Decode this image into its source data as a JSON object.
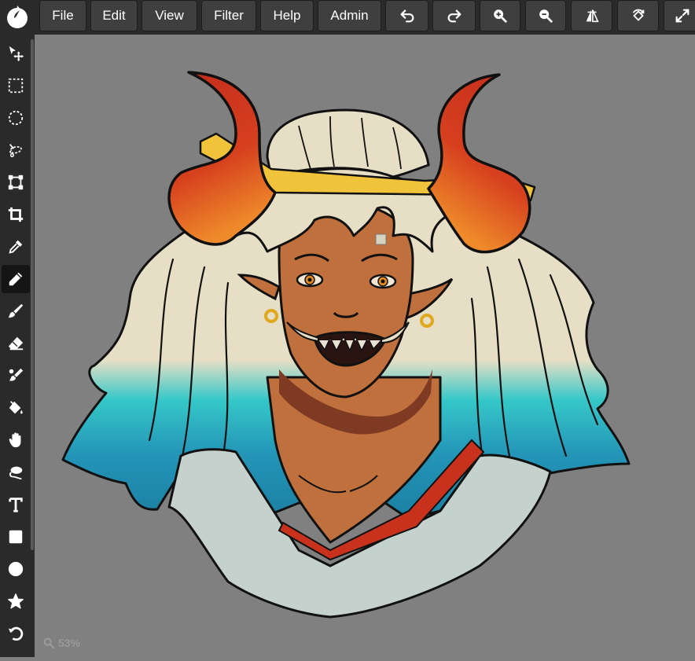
{
  "toolbar": {
    "logo_icon": "ink-drop-icon",
    "menus": [
      {
        "label": "File"
      },
      {
        "label": "Edit"
      },
      {
        "label": "View"
      },
      {
        "label": "Filter"
      },
      {
        "label": "Help"
      },
      {
        "label": "Admin"
      }
    ],
    "actions": [
      "undo-icon",
      "redo-icon",
      "zoom-in-icon",
      "zoom-out-icon",
      "flip-icon",
      "rotate-icon",
      "fullscreen-icon"
    ]
  },
  "tools": [
    {
      "name": "move-tool",
      "icon": "move-icon"
    },
    {
      "name": "rect-select-tool",
      "icon": "rect-select-icon"
    },
    {
      "name": "ellipse-select-tool",
      "icon": "ellipse-select-icon"
    },
    {
      "name": "lasso-tool",
      "icon": "lasso-icon"
    },
    {
      "name": "transform-tool",
      "icon": "transform-icon"
    },
    {
      "name": "crop-tool",
      "icon": "crop-icon"
    },
    {
      "name": "eyedropper-tool",
      "icon": "eyedropper-icon"
    },
    {
      "name": "pencil-tool",
      "icon": "pencil-icon",
      "active": true
    },
    {
      "name": "brush-tool",
      "icon": "brush-icon"
    },
    {
      "name": "eraser-tool",
      "icon": "eraser-icon"
    },
    {
      "name": "smudge-tool",
      "icon": "smudge-icon"
    },
    {
      "name": "bucket-tool",
      "icon": "paint-bucket-icon"
    },
    {
      "name": "hand-tool",
      "icon": "hand-icon"
    },
    {
      "name": "lasso-fill-tool",
      "icon": "lasso-fill-icon"
    },
    {
      "name": "text-tool",
      "icon": "text-icon"
    },
    {
      "name": "rectangle-tool",
      "icon": "rectangle-icon"
    },
    {
      "name": "circle-tool",
      "icon": "circle-icon"
    },
    {
      "name": "star-tool",
      "icon": "star-icon"
    },
    {
      "name": "history-tool",
      "icon": "history-icon"
    }
  ],
  "canvas": {
    "background": "#808080",
    "artwork": "character-illustration"
  },
  "status": {
    "zoom": "53%"
  },
  "colors": {
    "toolbar_bg": "#2a2a2a",
    "button_bg": "#3f3f3f",
    "canvas_bg": "#808080",
    "text": "#ffffff"
  }
}
